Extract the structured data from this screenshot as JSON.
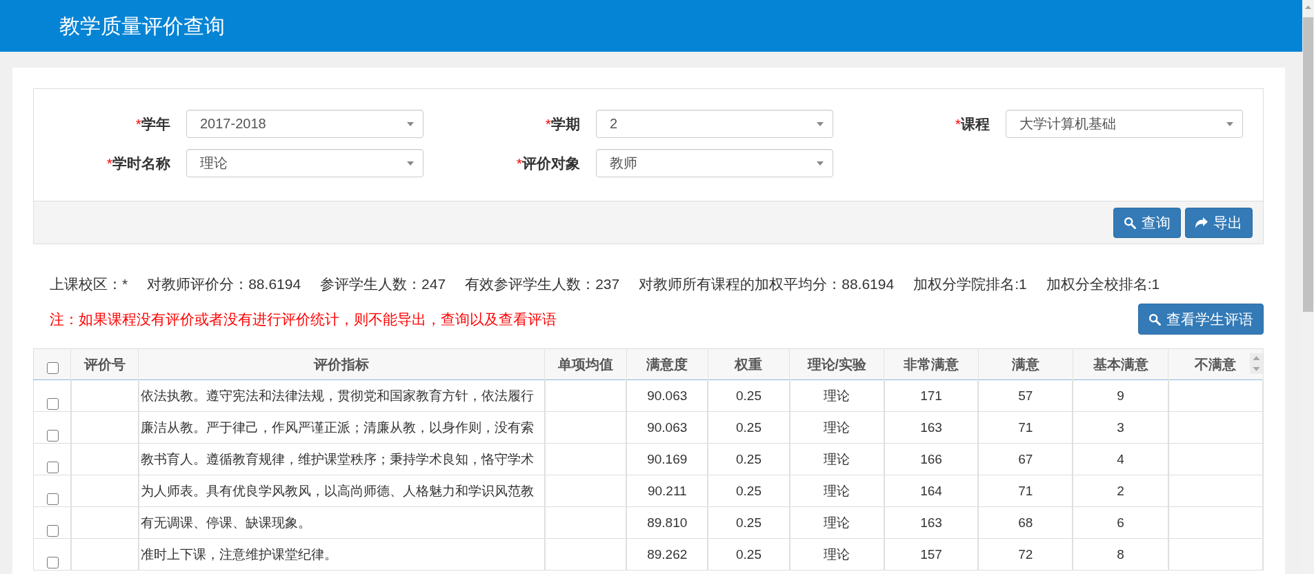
{
  "header": {
    "title": "教学质量评价查询"
  },
  "filters": {
    "fields": [
      {
        "mark": "*",
        "label": "学年",
        "value": "2017-2018"
      },
      {
        "mark": "*",
        "label": "学期",
        "value": "2"
      },
      {
        "mark": "*",
        "label": "课程",
        "value": "大学计算机基础"
      },
      {
        "mark": "*",
        "label": "学时名称",
        "value": "理论"
      },
      {
        "mark": "*",
        "label": "评价对象",
        "value": "教师"
      }
    ],
    "buttons": [
      {
        "kind": "search",
        "label": "查询"
      },
      {
        "kind": "export",
        "label": "导出"
      }
    ]
  },
  "summary": [
    "上课校区：*",
    "对教师评价分：88.6194",
    "参评学生人数：247",
    "有效参评学生人数：237",
    "对教师所有课程的加权平均分：88.6194",
    "加权分学院排名:1",
    "加权分全校排名:1"
  ],
  "note": "注：如果课程没有评价或者没有进行评价统计，则不能导出，查询以及查看评语",
  "comments_button": {
    "kind": "search",
    "label": "查看学生评语"
  },
  "table": {
    "all_checked": false,
    "columns": [
      "评价号",
      "评价指标",
      "单项均值",
      "满意度",
      "权重",
      "理论/实验",
      "非常满意",
      "满意",
      "基本满意",
      "不满意"
    ],
    "rows": [
      {
        "checked": false,
        "cells": [
          null,
          "依法执教。遵守宪法和法律法规，贯彻党和国家教育方针，依法履行",
          null,
          "90.063",
          "0.25",
          "理论",
          "171",
          "57",
          "9",
          null
        ]
      },
      {
        "checked": false,
        "cells": [
          null,
          "廉洁从教。严于律己，作风严谨正派；清廉从教，以身作则，没有索",
          null,
          "90.063",
          "0.25",
          "理论",
          "163",
          "71",
          "3",
          null
        ]
      },
      {
        "checked": false,
        "cells": [
          null,
          "教书育人。遵循教育规律，维护课堂秩序；秉持学术良知，恪守学术",
          null,
          "90.169",
          "0.25",
          "理论",
          "166",
          "67",
          "4",
          null
        ]
      },
      {
        "checked": false,
        "cells": [
          null,
          "为人师表。具有优良学风教风，以高尚师德、人格魅力和学识风范教",
          null,
          "90.211",
          "0.25",
          "理论",
          "164",
          "71",
          "2",
          null
        ]
      },
      {
        "checked": false,
        "cells": [
          null,
          "有无调课、停课、缺课现象。",
          null,
          "89.810",
          "0.25",
          "理论",
          "163",
          "68",
          "6",
          null
        ]
      },
      {
        "checked": false,
        "cells": [
          null,
          "准时上下课，注意维护课堂纪律。",
          null,
          "89.262",
          "0.25",
          "理论",
          "157",
          "72",
          "8",
          null
        ]
      }
    ]
  }
}
